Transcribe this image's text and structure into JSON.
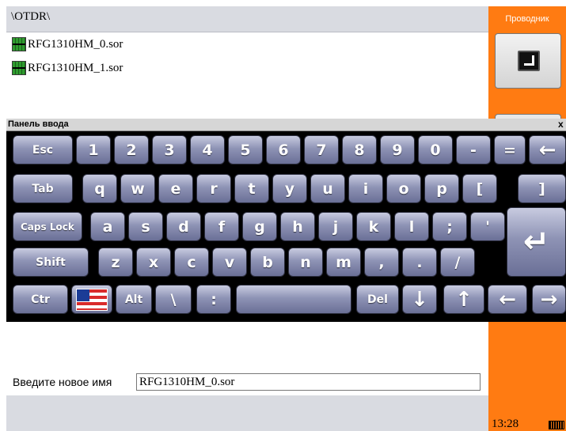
{
  "file_browser": {
    "path": "\\OTDR\\",
    "files": [
      {
        "name": "RFG1310HM_0.sor",
        "icon": "sor-file-icon"
      },
      {
        "name": "RFG1310HM_1.sor",
        "icon": "sor-file-icon"
      }
    ]
  },
  "right_panel": {
    "title": "Проводник",
    "clock": "13:28"
  },
  "input_panel": {
    "title": "Панель ввода",
    "close": "x",
    "rows": [
      [
        "Esc",
        "1",
        "2",
        "3",
        "4",
        "5",
        "6",
        "7",
        "8",
        "9",
        "0",
        "-",
        "=",
        "←"
      ],
      [
        "Tab",
        "q",
        "w",
        "e",
        "r",
        "t",
        "y",
        "u",
        "i",
        "o",
        "p",
        "[",
        "]"
      ],
      [
        "Caps Lock",
        "a",
        "s",
        "d",
        "f",
        "g",
        "h",
        "j",
        "k",
        "l",
        ";",
        "'",
        "↵"
      ],
      [
        "Shift",
        "z",
        "x",
        "c",
        "v",
        "b",
        "n",
        "m",
        ",",
        ".",
        "/"
      ],
      [
        "Ctr",
        "",
        "Alt",
        "\\",
        ":",
        "",
        "Del",
        "↓",
        "↑",
        "←",
        "→"
      ]
    ]
  },
  "rename": {
    "label": "Введите новое имя",
    "value": "RFG1310HM_0.sor"
  },
  "colors": {
    "accent_orange": "#ff7b12",
    "key_blue": "#8e93b5"
  }
}
